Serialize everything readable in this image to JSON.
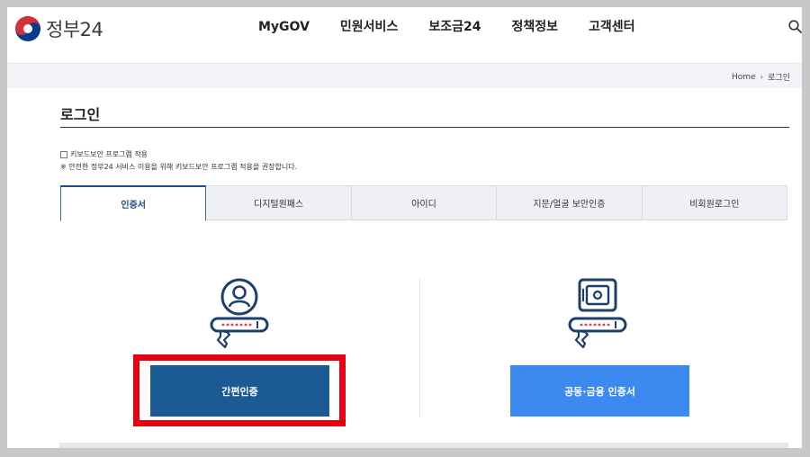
{
  "header": {
    "logo_text": "정부24",
    "nav": [
      "MyGOV",
      "민원서비스",
      "보조금24",
      "정책정보",
      "고객센터"
    ],
    "search_icon": "search-icon"
  },
  "breadcrumb": {
    "home": "Home",
    "current": "로그인"
  },
  "page": {
    "title": "로그인",
    "keyboard_option": "키보드보안 프로그램 적용",
    "keyboard_notice": "※ 안전한 정부24 서비스 이용을 위해 키보드보안 프로그램 적용을 권장합니다."
  },
  "tabs": [
    {
      "label": "인증서",
      "active": true
    },
    {
      "label": "디지털원패스",
      "active": false
    },
    {
      "label": "아이디",
      "active": false
    },
    {
      "label": "지문/얼굴 보안인증",
      "active": false
    },
    {
      "label": "비회원로그인",
      "active": false
    }
  ],
  "login_options": {
    "simple": {
      "button_label": "간편인증",
      "icon": "person-key-icon"
    },
    "certificate": {
      "button_label": "공동·금융 인증서",
      "icon": "safe-key-icon"
    }
  },
  "colors": {
    "highlight_frame": "#e60012",
    "simple_button": "#1b5a94",
    "certificate_button": "#3c8af0",
    "active_tab_text": "#174f8a"
  }
}
